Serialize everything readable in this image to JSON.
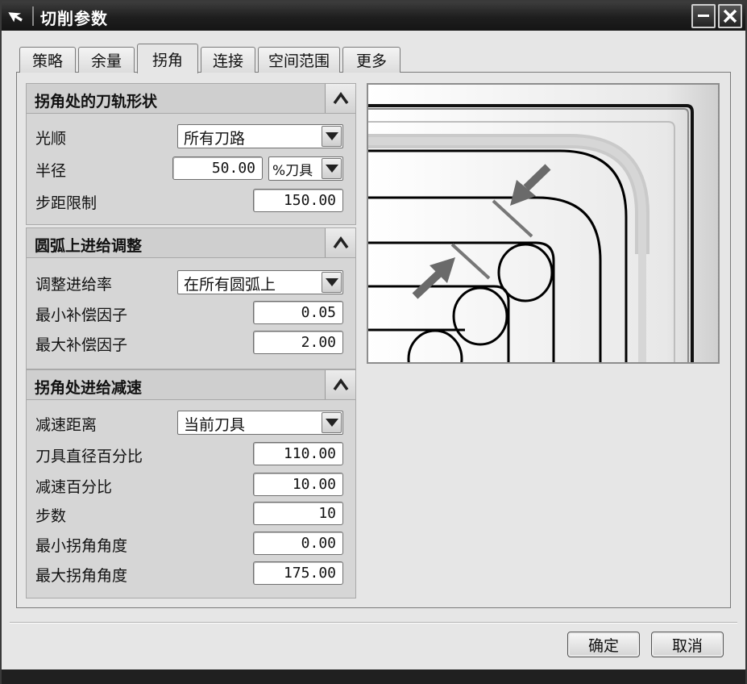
{
  "window": {
    "title": "切削参数"
  },
  "tabs": [
    {
      "label": "策略"
    },
    {
      "label": "余量"
    },
    {
      "label": "拐角"
    },
    {
      "label": "连接"
    },
    {
      "label": "空间范围"
    },
    {
      "label": "更多"
    }
  ],
  "active_tab": "拐角",
  "sections": {
    "corner_shape": {
      "title": "拐角处的刀轨形状",
      "smooth_label": "光顺",
      "smooth_value": "所有刀路",
      "radius_label": "半径",
      "radius_value": "50.00",
      "radius_unit": "%刀具",
      "stepover_label": "步距限制",
      "stepover_value": "150.00"
    },
    "arc_feed": {
      "title": "圆弧上进给调整",
      "adjust_label": "调整进给率",
      "adjust_value": "在所有圆弧上",
      "min_label": "最小补偿因子",
      "min_value": "0.05",
      "max_label": "最大补偿因子",
      "max_value": "2.00"
    },
    "slowdown": {
      "title": "拐角处进给减速",
      "distance_label": "减速距离",
      "distance_value": "当前刀具",
      "tooldia_label": "刀具直径百分比",
      "tooldia_value": "110.00",
      "pct_label": "减速百分比",
      "pct_value": "10.00",
      "steps_label": "步数",
      "steps_value": "10",
      "minangle_label": "最小拐角角度",
      "minangle_value": "0.00",
      "maxangle_label": "最大拐角角度",
      "maxangle_value": "175.00"
    }
  },
  "footer": {
    "ok": "确定",
    "cancel": "取消"
  },
  "icons": {
    "title": "cursor-arrow-icon",
    "minimize": "minimize-icon",
    "close": "close-icon",
    "collapse": "chevron-up-icon",
    "dropdown": "chevron-down-icon"
  }
}
